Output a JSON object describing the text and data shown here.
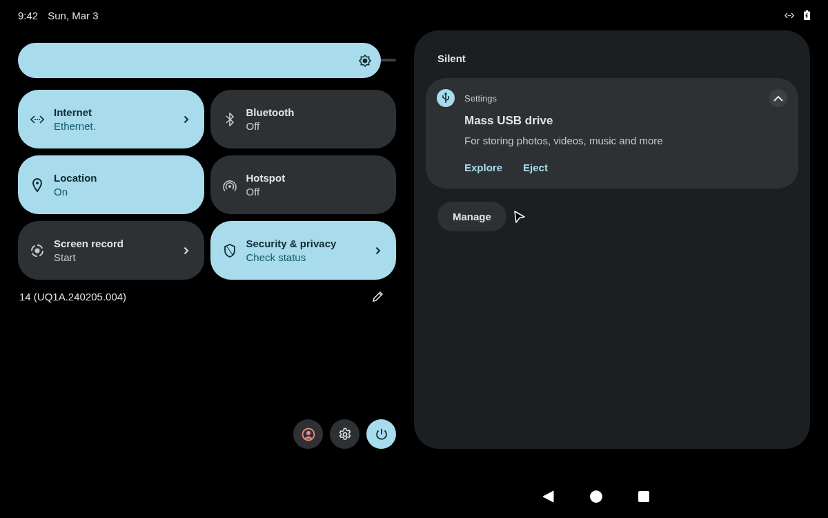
{
  "status_bar": {
    "time": "9:42",
    "date": "Sun, Mar 3"
  },
  "brightness": {
    "level": 0.96
  },
  "tiles": [
    {
      "label": "Internet",
      "state": "Ethernet.",
      "on": true,
      "chevron": true
    },
    {
      "label": "Bluetooth",
      "state": "Off",
      "on": false,
      "chevron": false
    },
    {
      "label": "Location",
      "state": "On",
      "on": true,
      "chevron": false
    },
    {
      "label": "Hotspot",
      "state": "Off",
      "on": false,
      "chevron": false
    },
    {
      "label": "Screen record",
      "state": "Start",
      "on": false,
      "chevron": true
    },
    {
      "label": "Security & privacy",
      "state": "Check status",
      "on": true,
      "chevron": true
    }
  ],
  "build_number": "14 (UQ1A.240205.004)",
  "notifications": {
    "section_title": "Silent",
    "items": [
      {
        "app": "Settings",
        "title": "Mass USB drive",
        "text": "For storing photos, videos, music and more",
        "expanded": true,
        "actions": [
          "Explore",
          "Eject"
        ]
      }
    ],
    "manage_button": "Manage"
  }
}
